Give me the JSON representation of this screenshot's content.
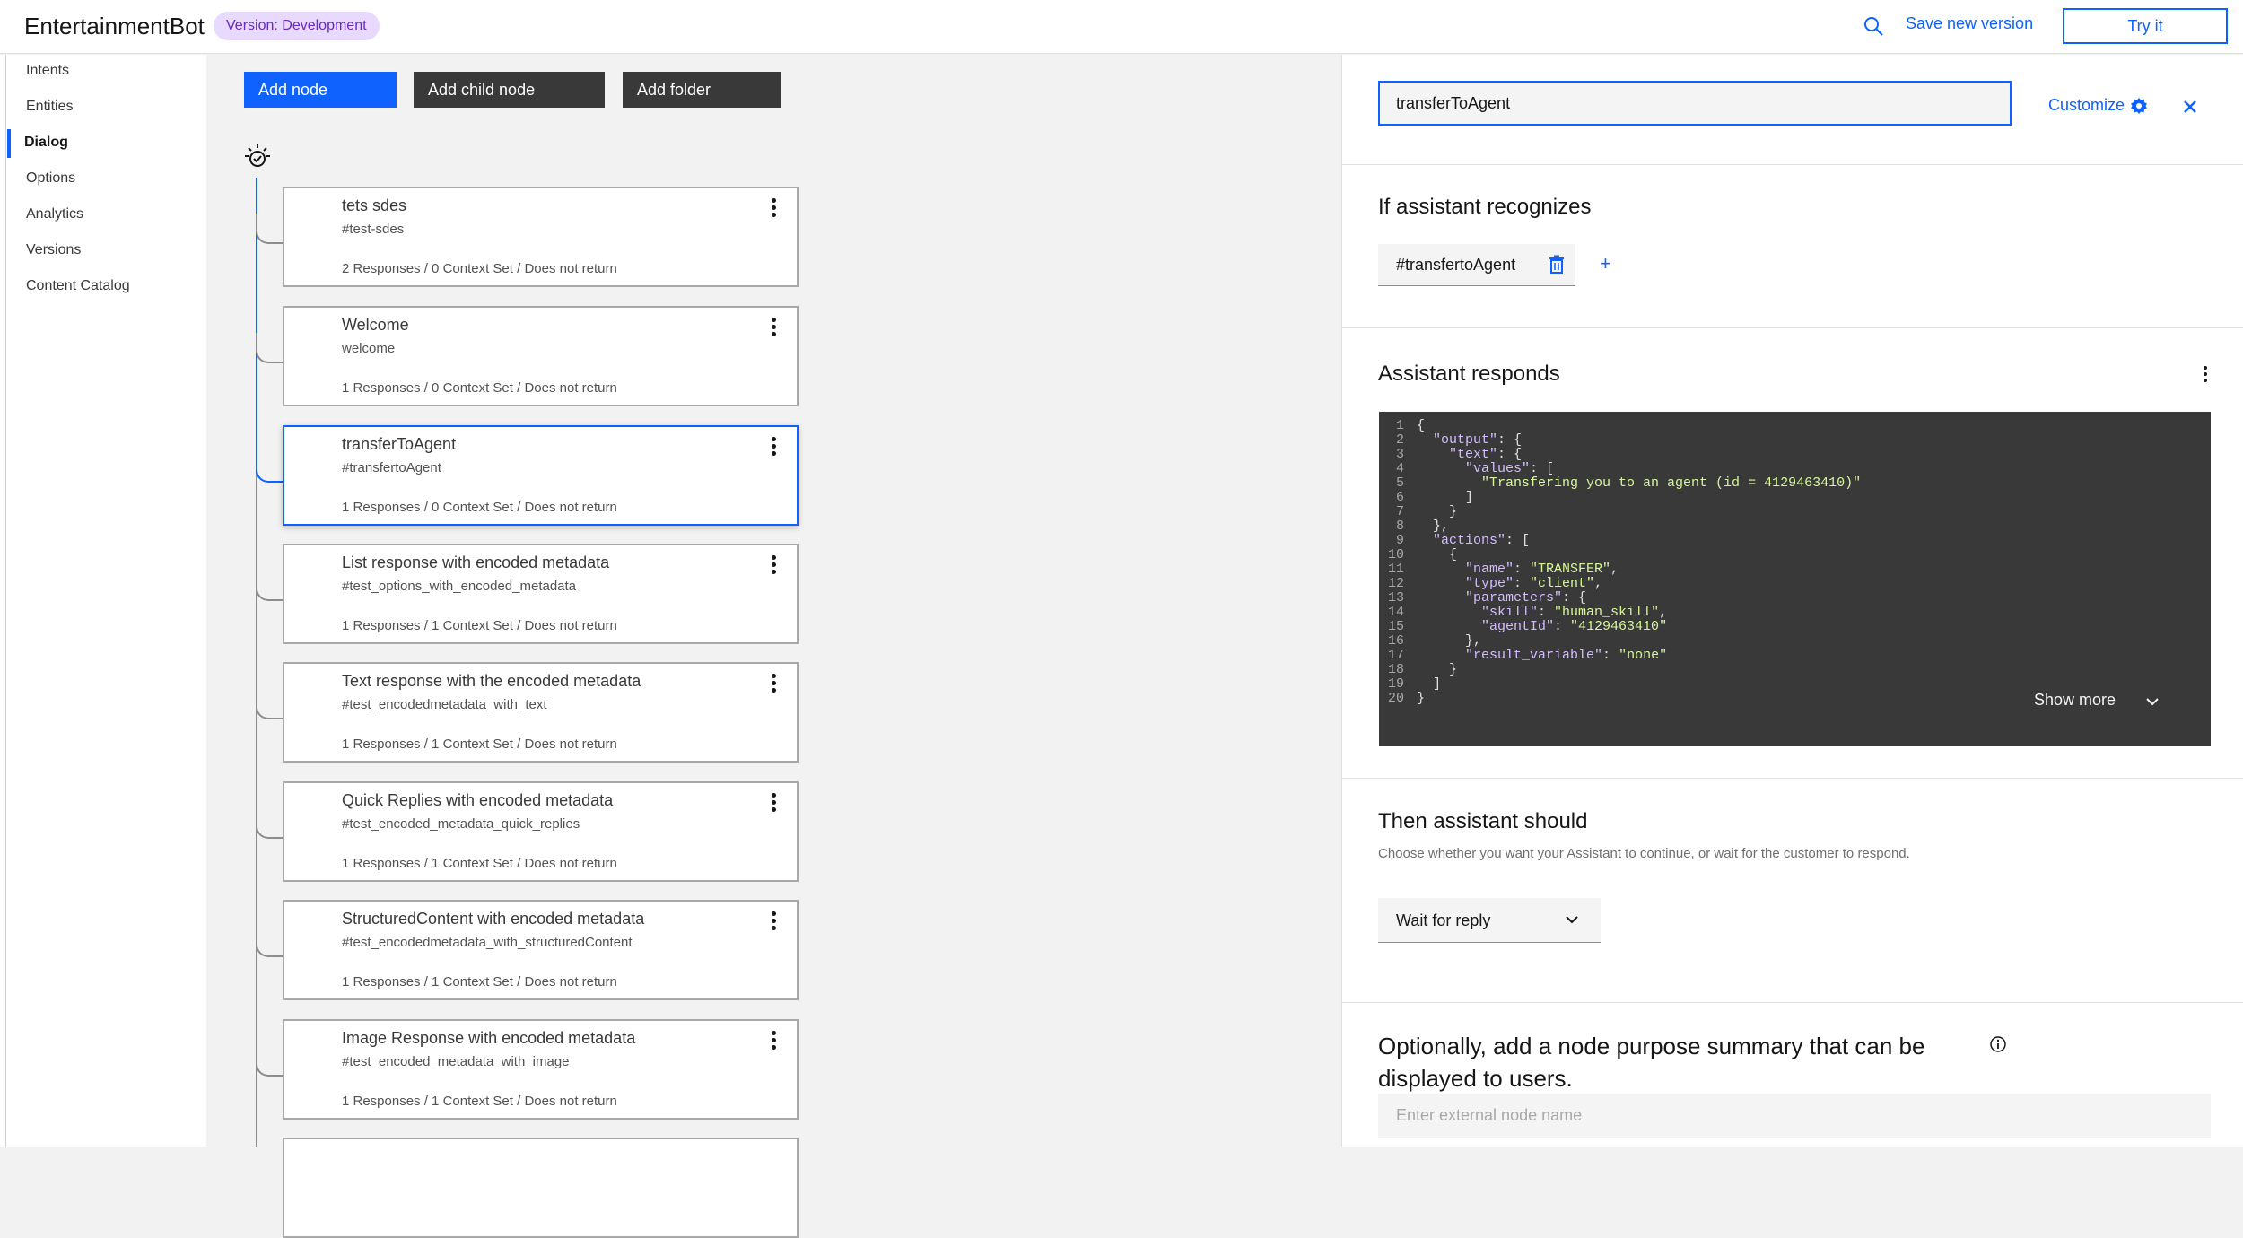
{
  "header": {
    "app_title": "EntertainmentBot",
    "version_tag": "Version: Development",
    "save_new_version": "Save new version",
    "try_it": "Try it"
  },
  "sidebar": {
    "items": [
      {
        "label": "Intents",
        "active": false
      },
      {
        "label": "Entities",
        "active": false
      },
      {
        "label": "Dialog",
        "active": true
      },
      {
        "label": "Options",
        "active": false
      },
      {
        "label": "Analytics",
        "active": false
      },
      {
        "label": "Versions",
        "active": false
      },
      {
        "label": "Content Catalog",
        "active": false
      }
    ]
  },
  "toolbar": {
    "add_node": "Add node",
    "add_child_node": "Add child node",
    "add_folder": "Add folder"
  },
  "nodes": [
    {
      "title": "tets sdes",
      "condition": "#test-sdes",
      "meta": "2 Responses / 0 Context Set / Does not return",
      "selected": false
    },
    {
      "title": "Welcome",
      "condition": "welcome",
      "meta": "1 Responses / 0 Context Set / Does not return",
      "selected": false
    },
    {
      "title": "transferToAgent",
      "condition": "#transfertoAgent",
      "meta": "1 Responses / 0 Context Set / Does not return",
      "selected": true
    },
    {
      "title": "List response with encoded metadata",
      "condition": "#test_options_with_encoded_metadata",
      "meta": "1 Responses / 1 Context Set / Does not return",
      "selected": false
    },
    {
      "title": "Text response with the encoded metadata",
      "condition": "#test_encodedmetadata_with_text",
      "meta": "1 Responses / 1 Context Set / Does not return",
      "selected": false
    },
    {
      "title": "Quick Replies with encoded metadata",
      "condition": "#test_encoded_metadata_quick_replies",
      "meta": "1 Responses / 1 Context Set / Does not return",
      "selected": false
    },
    {
      "title": "StructuredContent with encoded metadata",
      "condition": "#test_encodedmetadata_with_structuredContent",
      "meta": "1 Responses / 1 Context Set / Does not return",
      "selected": false
    },
    {
      "title": "Image Response with encoded metadata",
      "condition": "#test_encoded_metadata_with_image",
      "meta": "1 Responses / 1 Context Set / Does not return",
      "selected": false
    }
  ],
  "panel": {
    "node_name": "transferToAgent",
    "customize": "Customize",
    "recognizes_title": "If assistant recognizes",
    "intent_condition": "#transfertoAgent",
    "add_condition": "+",
    "responds_title": "Assistant responds",
    "code_lines": [
      [
        {
          "t": "p",
          "v": "{"
        }
      ],
      [
        {
          "t": "p",
          "v": "  "
        },
        {
          "t": "k",
          "v": "\"output\""
        },
        {
          "t": "p",
          "v": ": {"
        }
      ],
      [
        {
          "t": "p",
          "v": "    "
        },
        {
          "t": "k",
          "v": "\"text\""
        },
        {
          "t": "p",
          "v": ": {"
        }
      ],
      [
        {
          "t": "p",
          "v": "      "
        },
        {
          "t": "k",
          "v": "\"values\""
        },
        {
          "t": "p",
          "v": ": ["
        }
      ],
      [
        {
          "t": "p",
          "v": "        "
        },
        {
          "t": "s",
          "v": "\"Transfering you to an agent (id = 4129463410)\""
        }
      ],
      [
        {
          "t": "p",
          "v": "      ]"
        }
      ],
      [
        {
          "t": "p",
          "v": "    }"
        }
      ],
      [
        {
          "t": "p",
          "v": "  },"
        }
      ],
      [
        {
          "t": "p",
          "v": "  "
        },
        {
          "t": "k",
          "v": "\"actions\""
        },
        {
          "t": "p",
          "v": ": ["
        }
      ],
      [
        {
          "t": "p",
          "v": "    {"
        }
      ],
      [
        {
          "t": "p",
          "v": "      "
        },
        {
          "t": "k",
          "v": "\"name\""
        },
        {
          "t": "p",
          "v": ": "
        },
        {
          "t": "s",
          "v": "\"TRANSFER\""
        },
        {
          "t": "p",
          "v": ","
        }
      ],
      [
        {
          "t": "p",
          "v": "      "
        },
        {
          "t": "k",
          "v": "\"type\""
        },
        {
          "t": "p",
          "v": ": "
        },
        {
          "t": "s",
          "v": "\"client\""
        },
        {
          "t": "p",
          "v": ","
        }
      ],
      [
        {
          "t": "p",
          "v": "      "
        },
        {
          "t": "k",
          "v": "\"parameters\""
        },
        {
          "t": "p",
          "v": ": {"
        }
      ],
      [
        {
          "t": "p",
          "v": "        "
        },
        {
          "t": "k",
          "v": "\"skill\""
        },
        {
          "t": "p",
          "v": ": "
        },
        {
          "t": "s",
          "v": "\"human_skill\""
        },
        {
          "t": "p",
          "v": ","
        }
      ],
      [
        {
          "t": "p",
          "v": "        "
        },
        {
          "t": "k",
          "v": "\"agentId\""
        },
        {
          "t": "p",
          "v": ": "
        },
        {
          "t": "s",
          "v": "\"4129463410\""
        }
      ],
      [
        {
          "t": "p",
          "v": "      },"
        }
      ],
      [
        {
          "t": "p",
          "v": "      "
        },
        {
          "t": "k",
          "v": "\"result_variable\""
        },
        {
          "t": "p",
          "v": ": "
        },
        {
          "t": "s",
          "v": "\"none\""
        }
      ],
      [
        {
          "t": "p",
          "v": "    }"
        }
      ],
      [
        {
          "t": "p",
          "v": "  ]"
        }
      ],
      [
        {
          "t": "p",
          "v": "}"
        }
      ]
    ],
    "show_more": "Show more",
    "then_title": "Then assistant should",
    "then_desc": "Choose whether you want your Assistant to continue, or wait for the customer to respond.",
    "wait_option": "Wait for reply",
    "summary_title": "Optionally, add a node purpose summary that can be displayed to users.",
    "ext_name_placeholder": "Enter external node name"
  },
  "colors": {
    "accent": "#0f62fe",
    "dark_button": "#393939",
    "tag_bg": "#e8daff",
    "tag_text": "#6929c4",
    "code_bg": "#393939",
    "code_key": "#d4bbff",
    "code_string": "#d6f59a"
  },
  "icons": [
    "search-icon",
    "gear-icon",
    "close-icon",
    "trash-icon",
    "chevron-down-icon",
    "info-icon",
    "overflow-menu-icon",
    "watson-root-icon"
  ]
}
